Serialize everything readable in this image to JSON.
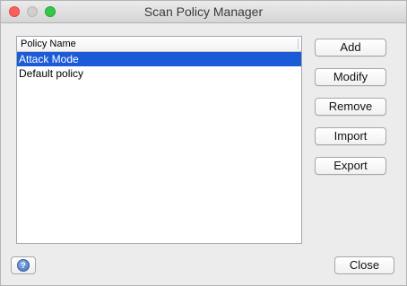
{
  "window": {
    "title": "Scan Policy Manager"
  },
  "policy_list": {
    "column_header": "Policy Name",
    "rows": [
      {
        "name": "Attack Mode",
        "selected": true
      },
      {
        "name": "Default policy",
        "selected": false
      }
    ]
  },
  "buttons": {
    "add": "Add",
    "modify": "Modify",
    "remove": "Remove",
    "import": "Import",
    "export": "Export",
    "close": "Close"
  },
  "icons": {
    "help": "help-icon"
  },
  "colors": {
    "selection": "#1c5bd8",
    "close_light": "#fc605c",
    "zoom_light": "#34c84a"
  }
}
